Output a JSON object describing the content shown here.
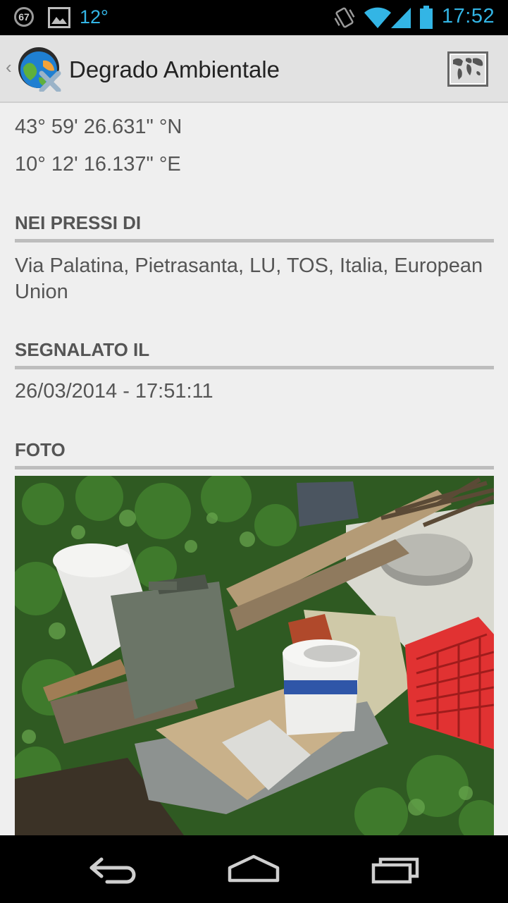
{
  "status_bar": {
    "notification_badge": "67",
    "temperature": "12°",
    "time": "17:52"
  },
  "action_bar": {
    "up_indicator": "‹",
    "title": "Degrado Ambientale",
    "map_icon": "world-map-icon",
    "logo_icon": "globe-logo-icon"
  },
  "location": {
    "latitude": "43° 59' 26.631\" °N",
    "longitude": "10° 12' 16.137\" °E"
  },
  "sections": {
    "nearby": {
      "heading": "NEI PRESSI DI",
      "value": "Via Palatina, Pietrasanta, LU, TOS, Italia, European Union"
    },
    "reported": {
      "heading": "SEGNALATO IL",
      "value": "26/03/2014 - 17:51:11"
    },
    "photo": {
      "heading": "FOTO"
    }
  },
  "nav_bar": {
    "back_icon": "back-icon",
    "home_icon": "home-icon",
    "recents_icon": "recent-apps-icon"
  },
  "colors": {
    "accent": "#33b5e5",
    "background": "#efefef",
    "text": "#555555",
    "divider": "#bdbdbd"
  }
}
